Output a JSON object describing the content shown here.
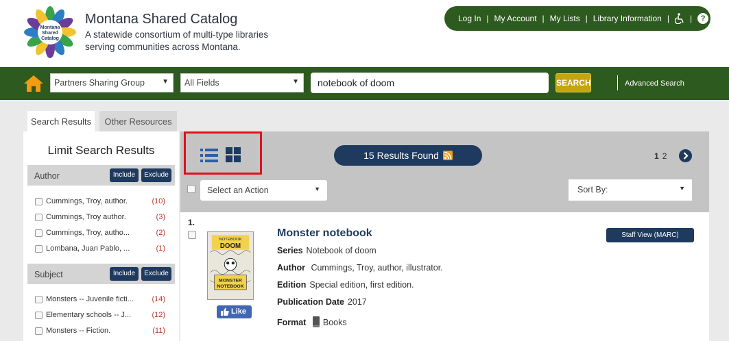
{
  "header": {
    "title": "Montana Shared Catalog",
    "subtitle": "A statewide consortium of multi-type libraries serving communities across Montana.",
    "logo_text": [
      "Montana",
      "Shared",
      "Catalog"
    ],
    "links": [
      "Log In",
      "My Account",
      "My Lists",
      "Library Information"
    ],
    "accessibility_icon": "wheelchair-icon",
    "help_icon": "help-icon",
    "help_glyph": "?"
  },
  "search": {
    "scope": "Partners Sharing Group",
    "field": "All Fields",
    "query": "notebook of doom",
    "button": "SEARCH",
    "advanced": "Advanced Search"
  },
  "tabs": {
    "active": "Search Results",
    "other": "Other Resources"
  },
  "facets": {
    "title": "Limit Search Results",
    "include_label": "Include",
    "exclude_label": "Exclude",
    "groups": [
      {
        "name": "Author",
        "items": [
          {
            "label": "Cummings, Troy, author.",
            "count": "(10)"
          },
          {
            "label": "Cummings, Troy author.",
            "count": "(3)"
          },
          {
            "label": "Cummings, Troy, autho...",
            "count": "(2)"
          },
          {
            "label": "Lombana, Juan Pablo, ...",
            "count": "(1)"
          }
        ]
      },
      {
        "name": "Subject",
        "items": [
          {
            "label": "Monsters -- Juvenile ficti...",
            "count": "(14)"
          },
          {
            "label": "Elementary schools -- J...",
            "count": "(12)"
          },
          {
            "label": "Monsters -- Fiction.",
            "count": "(11)"
          }
        ]
      }
    ]
  },
  "results": {
    "found": "15 Results Found",
    "pages": [
      "1",
      "2"
    ],
    "action_placeholder": "Select an Action",
    "sort_label": "Sort By:",
    "items": [
      {
        "number": "1.",
        "title": "Monster notebook",
        "series_label": "Series",
        "series": "Notebook of doom",
        "author_label": "Author",
        "author": "Cummings, Troy, author, illustrator.",
        "edition_label": "Edition",
        "edition": "Special edition, first edition.",
        "pubdate_label": "Publication Date",
        "pubdate": "2017",
        "format_label": "Format",
        "format": "Books",
        "staff_view": "Staff View (MARC)",
        "like": "Like",
        "cover_text": [
          "NOTEBOOK",
          "DOOM",
          "MONSTER",
          "NOTEBOOK"
        ]
      }
    ]
  },
  "colors": {
    "brand_green": "#2d5a1e",
    "navy": "#1f3a5f",
    "search_gold": "#c5a50e",
    "count_red": "#c0392b",
    "highlight_red": "#e0101c"
  }
}
